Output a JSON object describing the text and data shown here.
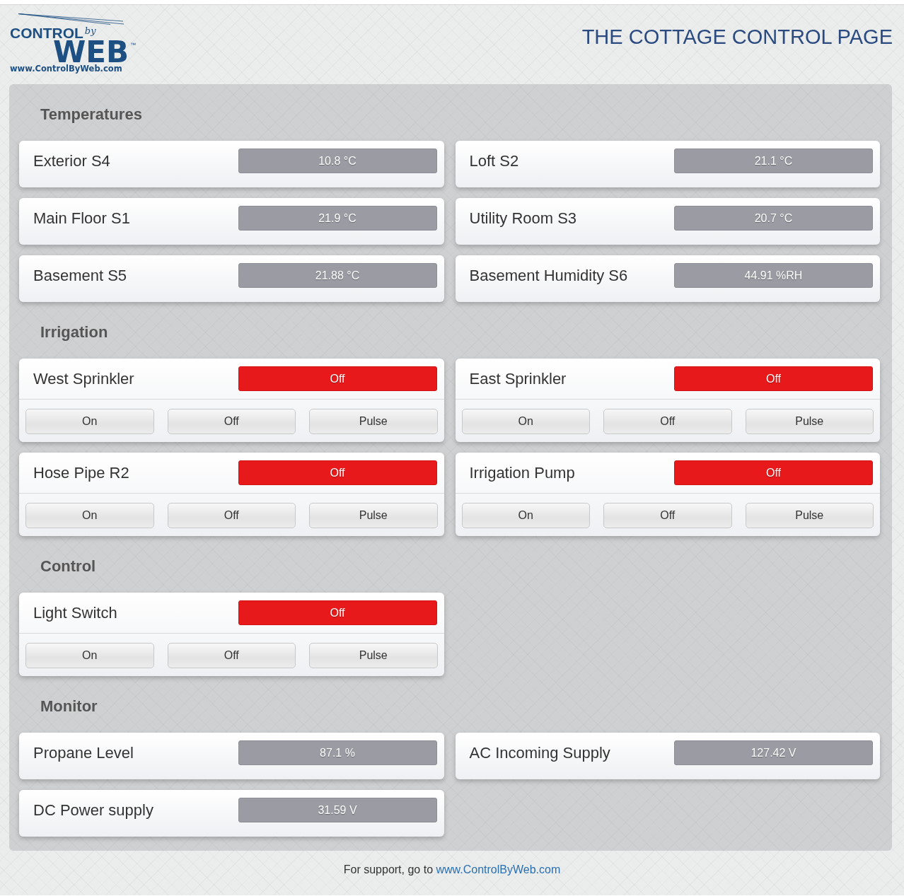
{
  "header": {
    "logo": {
      "brand_top": "CONTROL",
      "brand_by": "by",
      "brand_main": "WEB",
      "trademark": "™",
      "url": "www.ControlByWeb.com"
    },
    "title": "THE COTTAGE CONTROL PAGE"
  },
  "sections": [
    {
      "title": "Temperatures",
      "cards": [
        {
          "kind": "display",
          "label": "Exterior S4",
          "value": "10.8 °C"
        },
        {
          "kind": "display",
          "label": "Loft S2",
          "value": "21.1 °C"
        },
        {
          "kind": "display",
          "label": "Main Floor S1",
          "value": "21.9 °C"
        },
        {
          "kind": "display",
          "label": "Utility Room S3",
          "value": "20.7 °C"
        },
        {
          "kind": "display",
          "label": "Basement S5",
          "value": "21.88 °C"
        },
        {
          "kind": "display",
          "label": "Basement Humidity S6",
          "value": "44.91 %RH"
        }
      ]
    },
    {
      "title": "Irrigation",
      "cards": [
        {
          "kind": "relay",
          "label": "West Sprinkler",
          "state": "Off",
          "on": false,
          "buttons": [
            "On",
            "Off",
            "Pulse"
          ]
        },
        {
          "kind": "relay",
          "label": "East Sprinkler",
          "state": "Off",
          "on": false,
          "buttons": [
            "On",
            "Off",
            "Pulse"
          ]
        },
        {
          "kind": "relay",
          "label": "Hose Pipe R2",
          "state": "Off",
          "on": false,
          "buttons": [
            "On",
            "Off",
            "Pulse"
          ]
        },
        {
          "kind": "relay",
          "label": "Irrigation Pump",
          "state": "Off",
          "on": false,
          "buttons": [
            "On",
            "Off",
            "Pulse"
          ]
        }
      ]
    },
    {
      "title": "Control",
      "cards": [
        {
          "kind": "relay",
          "label": "Light Switch",
          "state": "Off",
          "on": false,
          "buttons": [
            "On",
            "Off",
            "Pulse"
          ]
        }
      ]
    },
    {
      "title": "Monitor",
      "cards": [
        {
          "kind": "display",
          "label": "Propane Level",
          "value": "87.1 %"
        },
        {
          "kind": "display",
          "label": "AC Incoming Supply",
          "value": "127.42 V"
        },
        {
          "kind": "display",
          "label": "DC Power supply",
          "value": "31.59 V"
        }
      ]
    }
  ],
  "footer": {
    "text": "For support, go to",
    "link": "www.ControlByWeb.com"
  }
}
